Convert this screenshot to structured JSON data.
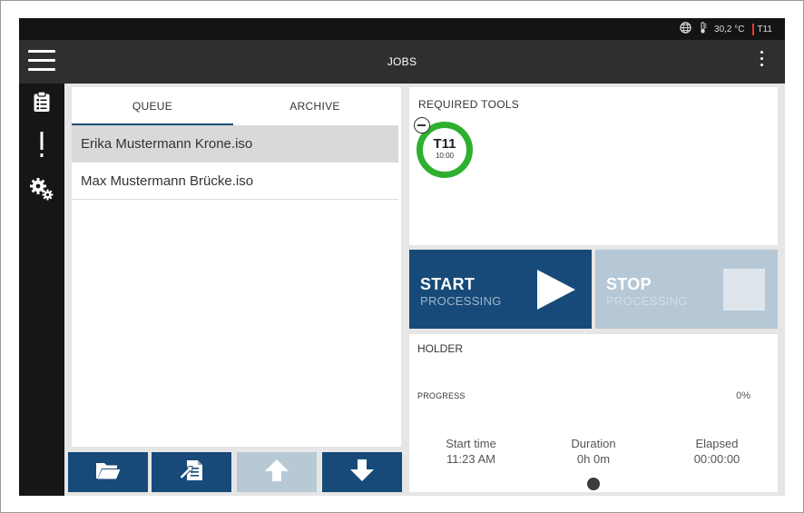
{
  "status_bar": {
    "temperature": "30,2 °C",
    "tool": "T11"
  },
  "title_bar": {
    "title": "JOBS"
  },
  "jobs": {
    "tabs": [
      {
        "label": "QUEUE",
        "active": true
      },
      {
        "label": "ARCHIVE",
        "active": false
      }
    ],
    "files": [
      {
        "name": "Erika Mustermann Krone.iso",
        "selected": true
      },
      {
        "name": "Max Mustermann Brücke.iso",
        "selected": false
      }
    ]
  },
  "required_tools": {
    "title": "REQUIRED TOOLS",
    "tools": [
      {
        "name": "T11",
        "time": "10:00",
        "ring_color": "#2eaf2e"
      }
    ]
  },
  "controls": {
    "start": {
      "line1": "START",
      "line2": "PROCESSING",
      "enabled": true
    },
    "stop": {
      "line1": "STOP",
      "line2": "PROCESSING",
      "enabled": false
    }
  },
  "holder": {
    "title": "HOLDER",
    "progress_label": "PROGRESS",
    "progress_value": "0%",
    "stats": {
      "start_time": {
        "label": "Start time",
        "value": "11:23 AM"
      },
      "duration": {
        "label": "Duration",
        "value": "0h 0m"
      },
      "elapsed": {
        "label": "Elapsed",
        "value": "00:00:00"
      }
    }
  },
  "action_buttons": [
    {
      "icon": "folder-open-icon",
      "enabled": true
    },
    {
      "icon": "import-file-icon",
      "enabled": true
    },
    {
      "icon": "arrow-up-icon",
      "enabled": false
    },
    {
      "icon": "arrow-down-icon",
      "enabled": true
    }
  ],
  "colors": {
    "primary": "#174a78",
    "primary_disabled": "#b6c8d6",
    "tool_ok": "#2eaf2e",
    "status_accent": "#e53935"
  }
}
